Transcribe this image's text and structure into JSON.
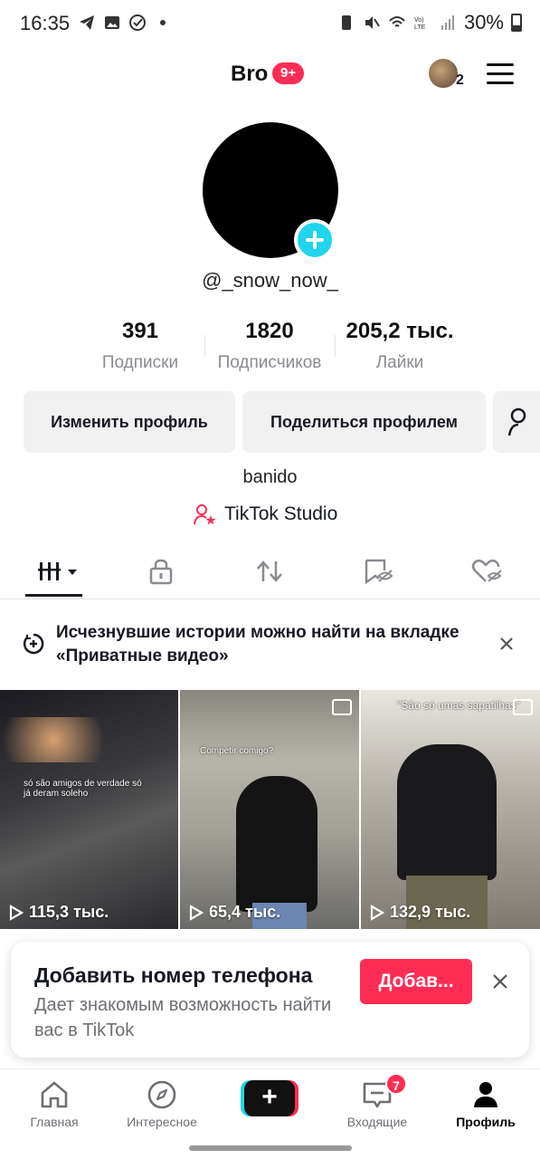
{
  "status_bar": {
    "time": "16:35",
    "battery": "30%",
    "icons": [
      "telegram-icon",
      "gallery-icon",
      "check-circle-icon",
      "dot-icon",
      "sim-icon",
      "mute-icon",
      "wifi-icon",
      "volte-icon",
      "signal-icon",
      "battery-icon"
    ]
  },
  "header": {
    "title": "Bro",
    "notification_badge": "9+",
    "friends_count": "2"
  },
  "profile": {
    "handle": "@_snow_now_",
    "bio": "banido",
    "studio_link": "TikTok Studio",
    "stats": [
      {
        "value": "391",
        "label": "Подписки"
      },
      {
        "value": "1820",
        "label": "Подписчиков"
      },
      {
        "value": "205,2 тыс.",
        "label": "Лайки"
      }
    ],
    "edit_button": "Изменить профиль",
    "share_button": "Поделиться профилем"
  },
  "tabs": [
    "grid-icon",
    "lock-icon",
    "repost-icon",
    "saved-hidden-icon",
    "liked-hidden-icon"
  ],
  "info_banner": {
    "text": "Исчезнувшие истории можно найти на вкладке «Приватные видео»"
  },
  "videos": [
    {
      "views": "115,3 тыс.",
      "caption": "só são amigos de verdade só já deram soleho"
    },
    {
      "views": "65,4 тыс.",
      "caption": "Competir comigo?"
    },
    {
      "views": "132,9 тыс.",
      "caption": "\"São só umas sapatilhas\""
    }
  ],
  "phone_prompt": {
    "title": "Добавить номер телефона",
    "subtitle": "Дает знакомым возможность найти вас в TikTok",
    "button": "Добав..."
  },
  "bottom_nav": {
    "items": [
      {
        "label": "Главная",
        "icon": "home-icon"
      },
      {
        "label": "Интересное",
        "icon": "compass-icon"
      },
      {
        "label": "Входящие",
        "icon": "inbox-icon",
        "badge": "7"
      },
      {
        "label": "Профиль",
        "icon": "profile-icon"
      }
    ]
  },
  "colors": {
    "accent": "#fe2c55",
    "cyan": "#20d5ec",
    "text": "#161823",
    "muted": "#8a8b91"
  }
}
